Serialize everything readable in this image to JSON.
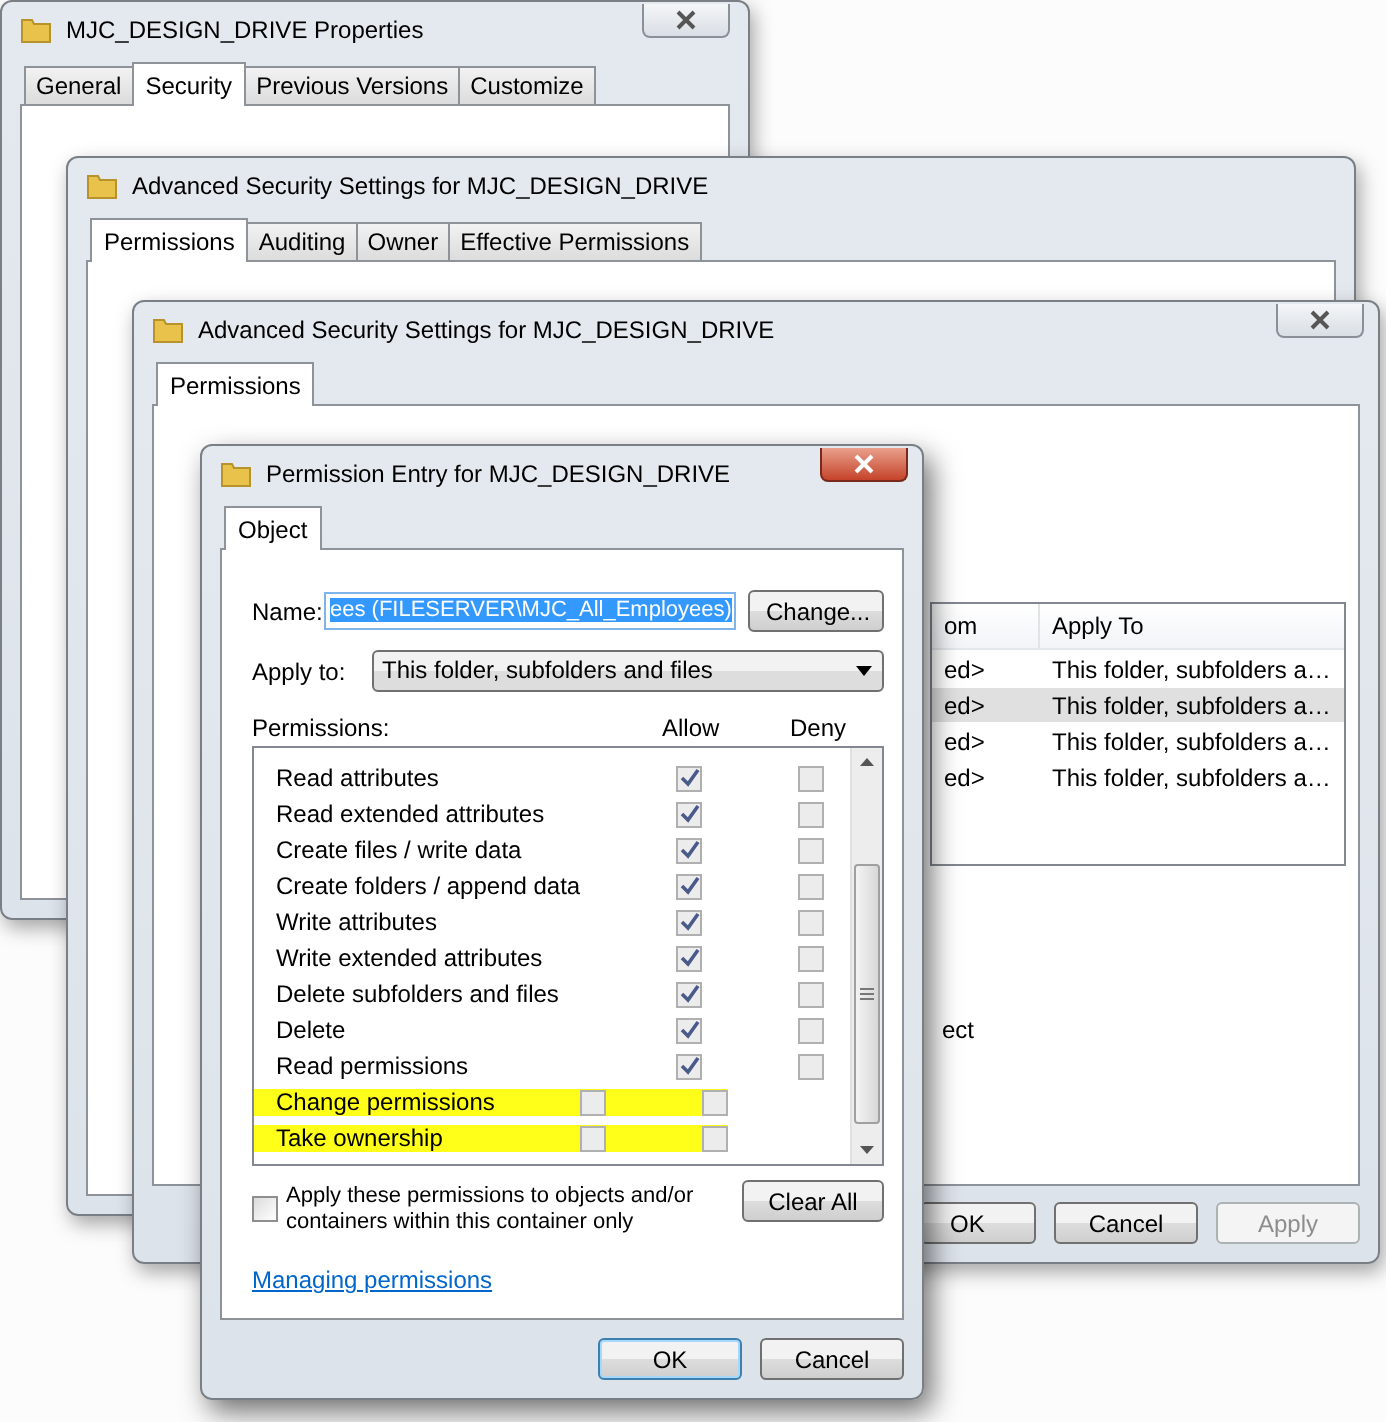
{
  "windows": [
    {
      "title": "MJC_DESIGN_DRIVE Properties",
      "tabs": [
        {
          "label": "General",
          "selected": false
        },
        {
          "label": "Security",
          "selected": true
        },
        {
          "label": "Previous Versions",
          "selected": false
        },
        {
          "label": "Customize",
          "selected": false
        }
      ]
    },
    {
      "title": "Advanced Security Settings for MJC_DESIGN_DRIVE",
      "tabs": [
        {
          "label": "Permissions",
          "selected": true
        },
        {
          "label": "Auditing",
          "selected": false
        },
        {
          "label": "Owner",
          "selected": false
        },
        {
          "label": "Effective Permissions",
          "selected": false
        }
      ]
    },
    {
      "title": "Advanced Security Settings for MJC_DESIGN_DRIVE",
      "tabs": [
        {
          "label": "Permissions",
          "selected": true
        }
      ],
      "table": {
        "columns": [
          "om",
          "Apply To"
        ],
        "rows": [
          {
            "cells": [
              "ed>",
              "This folder, subfolders a…"
            ],
            "selected": false
          },
          {
            "cells": [
              "ed>",
              "This folder, subfolders a…"
            ],
            "selected": true
          },
          {
            "cells": [
              "ed>",
              "This folder, subfolders a…"
            ],
            "selected": false
          },
          {
            "cells": [
              "ed>",
              "This folder, subfolders a…"
            ],
            "selected": false
          }
        ]
      },
      "text": "ect",
      "buttons": [
        {
          "label": "OK",
          "disabled": false
        },
        {
          "label": "Cancel",
          "disabled": false
        },
        {
          "label": "Apply",
          "disabled": true
        }
      ]
    }
  ],
  "entry": {
    "title": "Permission Entry for MJC_DESIGN_DRIVE",
    "tabs": [
      {
        "label": "Object",
        "selected": true
      }
    ],
    "name_label": "Name:",
    "name_value": "ees (FILESERVER\\MJC_All_Employees)",
    "change_button": "Change...",
    "apply_to_label": "Apply to:",
    "apply_to_value": "This folder, subfolders and files",
    "permissions_label": "Permissions:",
    "allow_label": "Allow",
    "deny_label": "Deny",
    "permissions": [
      {
        "name": "Read attributes",
        "allow": true,
        "deny": false,
        "highlighted": false
      },
      {
        "name": "Read extended attributes",
        "allow": true,
        "deny": false,
        "highlighted": false
      },
      {
        "name": "Create files / write data",
        "allow": true,
        "deny": false,
        "highlighted": false
      },
      {
        "name": "Create folders / append data",
        "allow": true,
        "deny": false,
        "highlighted": false
      },
      {
        "name": "Write attributes",
        "allow": true,
        "deny": false,
        "highlighted": false
      },
      {
        "name": "Write extended attributes",
        "allow": true,
        "deny": false,
        "highlighted": false
      },
      {
        "name": "Delete subfolders and files",
        "allow": true,
        "deny": false,
        "highlighted": false
      },
      {
        "name": "Delete",
        "allow": true,
        "deny": false,
        "highlighted": false
      },
      {
        "name": "Read permissions",
        "allow": true,
        "deny": false,
        "highlighted": false
      },
      {
        "name": "Change permissions",
        "allow": false,
        "deny": false,
        "highlighted": true
      },
      {
        "name": "Take ownership",
        "allow": false,
        "deny": false,
        "highlighted": true
      }
    ],
    "apply_only": {
      "label": "Apply these permissions to objects and/or containers within this container only",
      "checked": false
    },
    "clear_button": "Clear All",
    "link": "Managing permissions",
    "buttons": [
      {
        "label": "OK",
        "default": true
      },
      {
        "label": "Cancel",
        "default": false
      }
    ]
  }
}
